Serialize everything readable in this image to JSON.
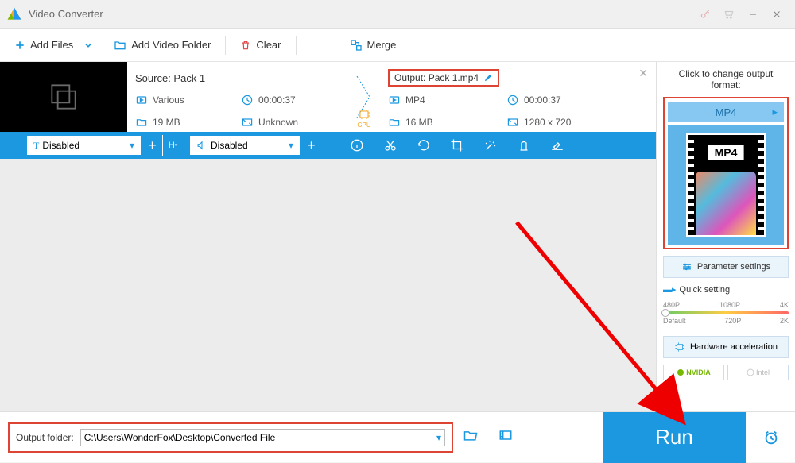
{
  "app": {
    "title": "Video Converter"
  },
  "toolbar": {
    "add_files": "Add Files",
    "add_folder": "Add Video Folder",
    "clear": "Clear",
    "merge": "Merge"
  },
  "file": {
    "source_label": "Source: Pack 1",
    "output_label": "Output: Pack 1.mp4",
    "src": {
      "codec": "Various",
      "duration": "00:00:37",
      "size": "19 MB",
      "res": "Unknown"
    },
    "out": {
      "codec": "MP4",
      "duration": "00:00:37",
      "size": "16 MB",
      "res": "1280 x 720"
    },
    "gpu": "GPU"
  },
  "editbar": {
    "text_setting": "Disabled",
    "audio_setting": "Disabled"
  },
  "right": {
    "click_label": "Click to change output format:",
    "format": "MP4",
    "mp4_badge": "MP4",
    "param": "Parameter settings",
    "quick": "Quick setting",
    "q": {
      "p480": "480P",
      "p1080": "1080P",
      "p4k": "4K",
      "def": "Default",
      "p720": "720P",
      "p2k": "2K"
    },
    "hw": "Hardware acceleration",
    "nvidia": "NVIDIA",
    "intel": "Intel"
  },
  "bottom": {
    "label": "Output folder:",
    "path": "C:\\Users\\WonderFox\\Desktop\\Converted File",
    "run": "Run"
  }
}
